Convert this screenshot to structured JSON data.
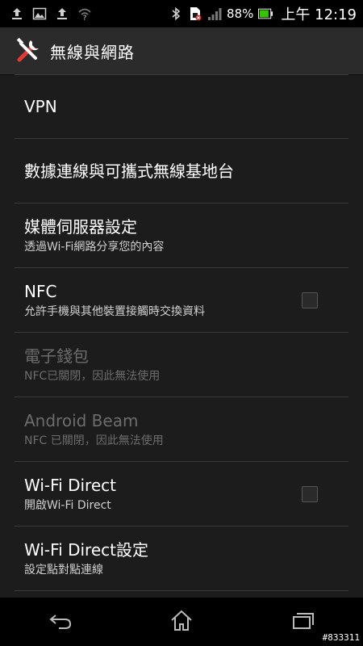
{
  "status_bar": {
    "icons_left": [
      "upload-icon",
      "image-icon",
      "upload-icon",
      "wifi-question-icon"
    ],
    "icons_right": [
      "bluetooth-icon",
      "sim-alert-icon",
      "signal-icon"
    ],
    "battery_percent": "88%",
    "battery_level": 0.88,
    "time": "上午 12:19"
  },
  "action_bar": {
    "icon": "tools-icon",
    "title": "無線與網路"
  },
  "settings": {
    "items": [
      {
        "title": "VPN",
        "summary": "",
        "enabled": true,
        "has_checkbox": false
      },
      {
        "title": "數據連線與可攜式無線基地台",
        "summary": "",
        "enabled": true,
        "has_checkbox": false
      },
      {
        "title": "媒體伺服器設定",
        "summary": "透過Wi-Fi網路分享您的內容",
        "enabled": true,
        "has_checkbox": false
      },
      {
        "title": "NFC",
        "summary": "允許手機與其他裝置接觸時交換資料",
        "enabled": true,
        "has_checkbox": true,
        "checked": false
      },
      {
        "title": "電子錢包",
        "summary": "NFC已關閉，因此無法使用",
        "enabled": false,
        "has_checkbox": false
      },
      {
        "title": "Android Beam",
        "summary": "NFC 已關閉，因此無法使用",
        "enabled": false,
        "has_checkbox": false
      },
      {
        "title": "Wi-Fi Direct",
        "summary": "開啟Wi-Fi Direct",
        "enabled": true,
        "has_checkbox": true,
        "checked": false
      },
      {
        "title": "Wi-Fi Direct設定",
        "summary": "設定點對點連線",
        "enabled": true,
        "has_checkbox": false
      }
    ]
  },
  "nav_bar": {
    "buttons": [
      "back-icon",
      "home-icon",
      "recent-apps-icon"
    ]
  },
  "watermark": "#833311"
}
